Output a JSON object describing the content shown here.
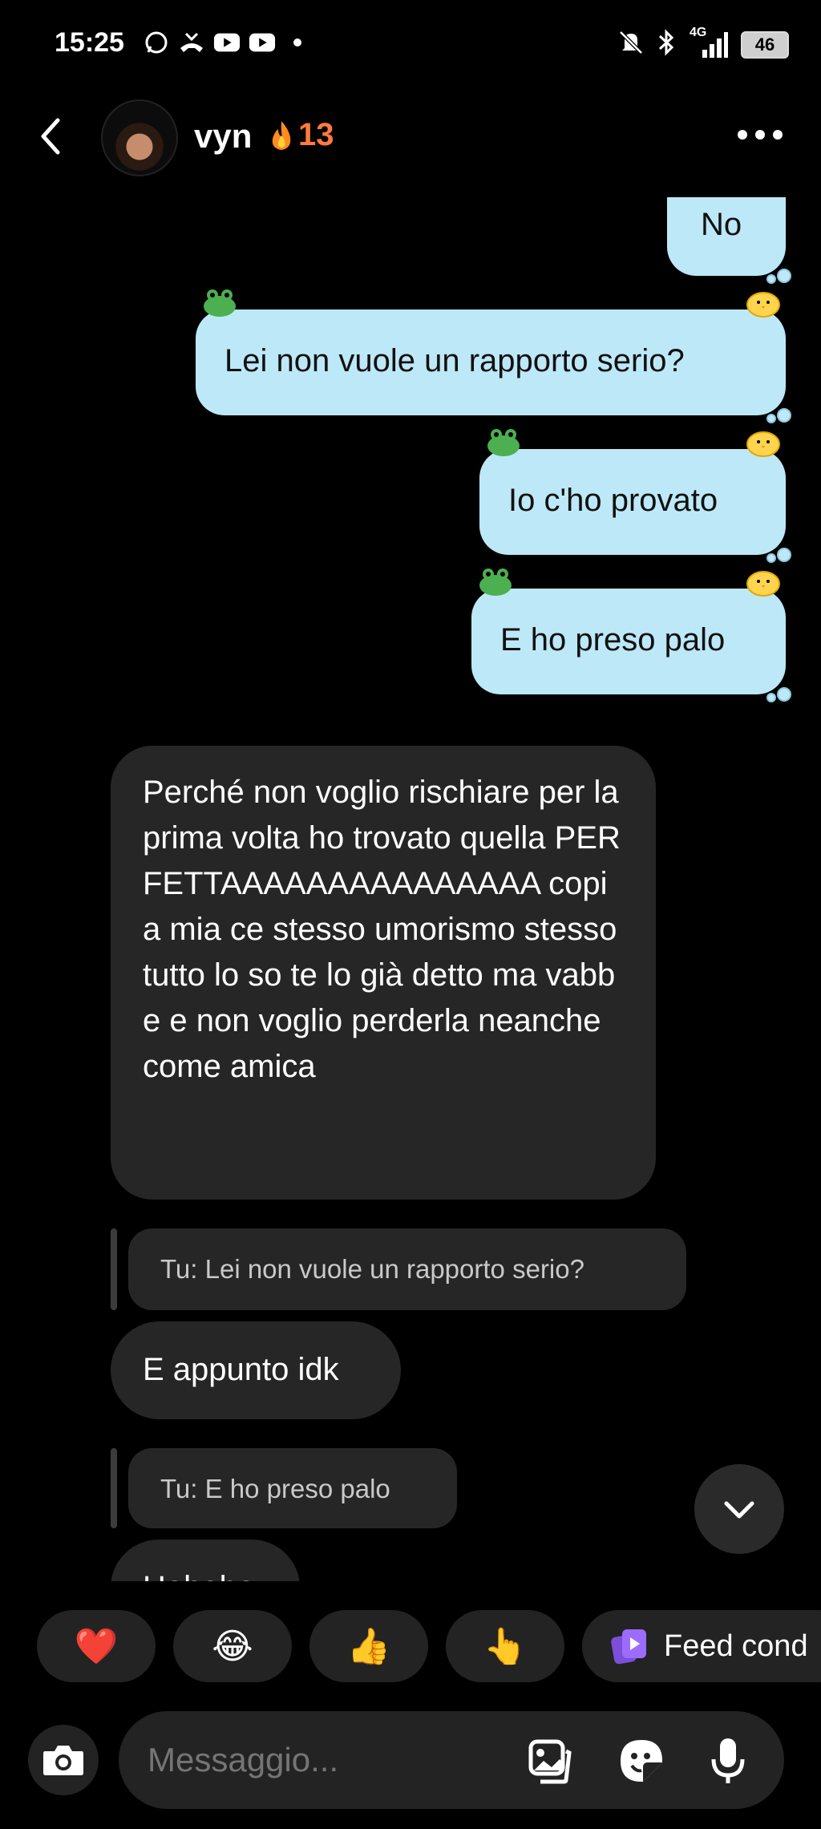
{
  "status_bar": {
    "time": "15:25",
    "battery": "46",
    "network": "4G",
    "icons": [
      "whatsapp-icon",
      "missed-call-icon",
      "youtube-icon",
      "youtube-icon",
      "dot-icon",
      "mute-icon",
      "bluetooth-icon",
      "signal-icon",
      "battery-icon"
    ]
  },
  "header": {
    "contact_name": "vyn",
    "streak_icon": "fire-icon",
    "streak_count": "13"
  },
  "messages": {
    "out_1": "No",
    "out_2": "Lei non vuole un rapporto serio?",
    "out_3": "Io c'ho provato",
    "out_4": "E ho preso palo",
    "in_1": "Perché non voglio rischiare per la prima volta ho trovato quella PERFETTAAAAAAAAAAAAAAA copia mia ce stesso umorismo stesso tutto lo so te lo già detto ma vabbe e non voglio perderla neanche come amica",
    "reply_1_context": "Tu: Lei non vuole un rapporto serio?",
    "in_2": "E appunto idk",
    "reply_2_context": "Tu: E ho preso palo",
    "in_3_partial": "Hahaha"
  },
  "quick_reactions": {
    "r1": "❤️",
    "r2": "😂",
    "r3": "👍",
    "r4": "👆",
    "feed_label": "Feed cond"
  },
  "composer": {
    "placeholder": "Messaggio..."
  },
  "colors": {
    "out_bubble": "#bde8f8",
    "in_bubble": "#262626",
    "streak": "#ff7a3d",
    "background": "#000000"
  }
}
